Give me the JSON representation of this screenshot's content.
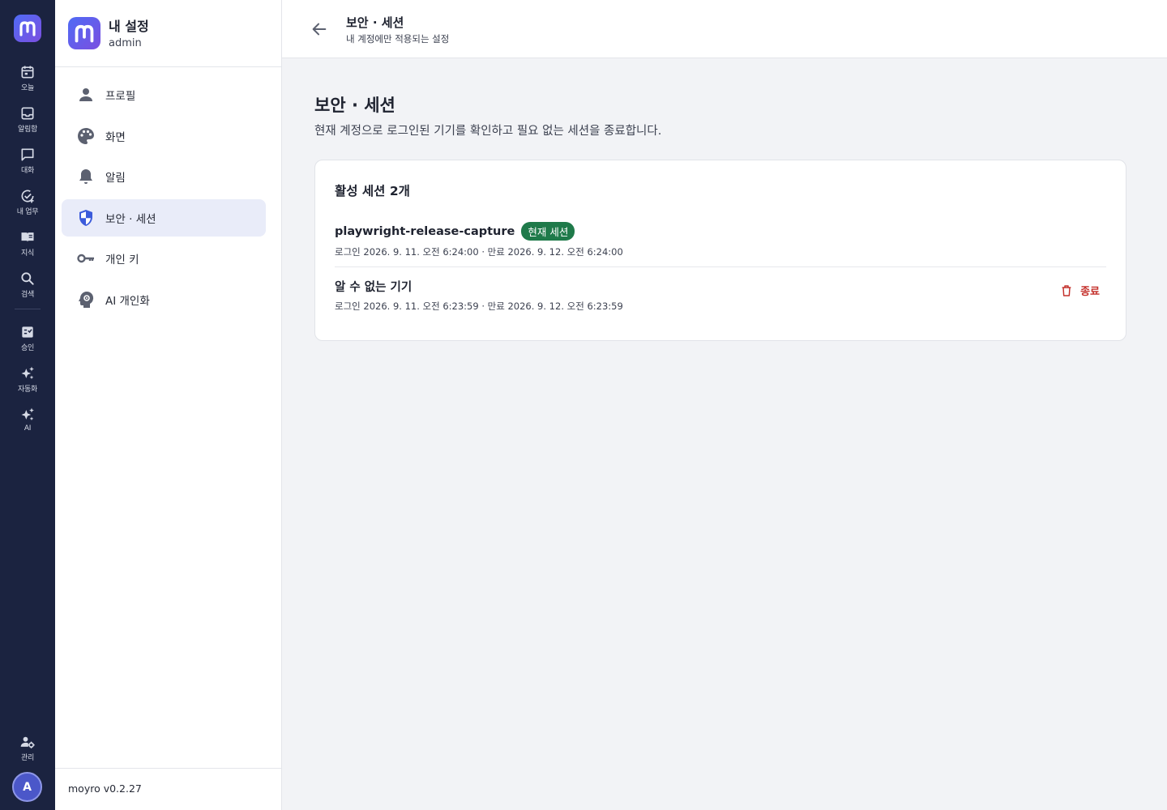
{
  "rail": {
    "items": [
      {
        "label": "오늘",
        "icon": "calendar-icon"
      },
      {
        "label": "알림함",
        "icon": "inbox-icon"
      },
      {
        "label": "대화",
        "icon": "chat-icon"
      },
      {
        "label": "내 업무",
        "icon": "task-check-icon"
      },
      {
        "label": "지식",
        "icon": "book-icon"
      },
      {
        "label": "검색",
        "icon": "search-icon"
      },
      {
        "label": "승인",
        "icon": "approval-icon"
      },
      {
        "label": "자동화",
        "icon": "sparkle-icon"
      },
      {
        "label": "AI",
        "icon": "ai-sparkle-icon"
      }
    ],
    "admin_label": "관리",
    "avatar": "A"
  },
  "sidebar": {
    "title": "내 설정",
    "user": "admin",
    "items": [
      {
        "label": "프로필",
        "icon": "person-icon"
      },
      {
        "label": "화면",
        "icon": "palette-icon"
      },
      {
        "label": "알림",
        "icon": "bell-icon"
      },
      {
        "label": "보안 · 세션",
        "icon": "shield-icon",
        "active": true
      },
      {
        "label": "개인 키",
        "icon": "key-icon"
      },
      {
        "label": "AI 개인화",
        "icon": "ai-head-icon"
      }
    ],
    "version": "moyro v0.2.27"
  },
  "topbar": {
    "title": "보안 · 세션",
    "subtitle": "내 계정에만 적용되는 설정"
  },
  "main": {
    "title": "보안 · 세션",
    "description": "현재 계정으로 로그인된 기기를 확인하고 필요 없는 세션을 종료합니다.",
    "card_title": "활성 세션 2개",
    "sessions": [
      {
        "device": "playwright-release-capture",
        "badge": "현재 세션",
        "meta": "로그인 2026. 9. 11. 오전 6:24:00 · 만료 2026. 9. 12. 오전 6:24:00"
      },
      {
        "device": "알 수 없는 기기",
        "meta": "로그인 2026. 9. 11. 오전 6:23:59 · 만료 2026. 9. 12. 오전 6:23:59",
        "action": "종료"
      }
    ]
  },
  "colors": {
    "rail_bg": "#1b2340",
    "accent": "#4f6bf5",
    "active_nav_bg": "#e9ecf9",
    "badge_green": "#1f7a4a",
    "danger": "#c4302b"
  }
}
